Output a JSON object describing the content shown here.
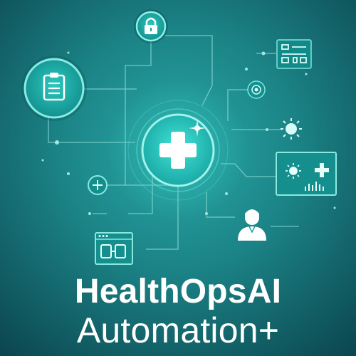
{
  "brand": {
    "title": "HealthOpsAI",
    "subtitle": "Automation+"
  },
  "colors": {
    "background_dark": "#0f4e56",
    "background_light": "#1f9a9c",
    "accent": "#39e0d0",
    "line": "#8fdcd8",
    "text": "#ffffff"
  },
  "icons": [
    "lock-icon",
    "clipboard-icon",
    "dashboard-panel-icon",
    "target-icon",
    "medical-cross-icon",
    "sun-icon",
    "analytics-monitor-icon",
    "plus-circle-icon",
    "browser-window-icon",
    "user-avatar-icon"
  ]
}
